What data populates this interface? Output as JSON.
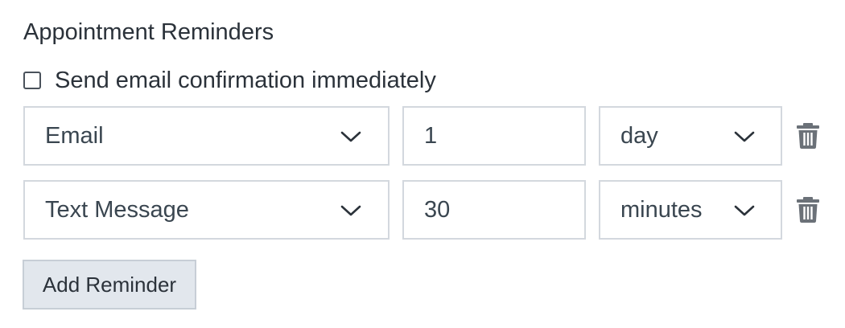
{
  "section": {
    "title": "Appointment Reminders"
  },
  "confirmation": {
    "label": "Send email confirmation immediately",
    "checked": false
  },
  "reminders": [
    {
      "method": "Email",
      "amount": "1",
      "unit": "day"
    },
    {
      "method": "Text Message",
      "amount": "30",
      "unit": "minutes"
    }
  ],
  "icons": {
    "dropdown": "chevron-down-icon",
    "delete": "trash-icon"
  },
  "actions": {
    "add_label": "Add Reminder"
  },
  "colors": {
    "border": "#d3d8de",
    "button_bg": "#e2e7ed",
    "icon": "#6b7178",
    "text": "#2b323a"
  }
}
